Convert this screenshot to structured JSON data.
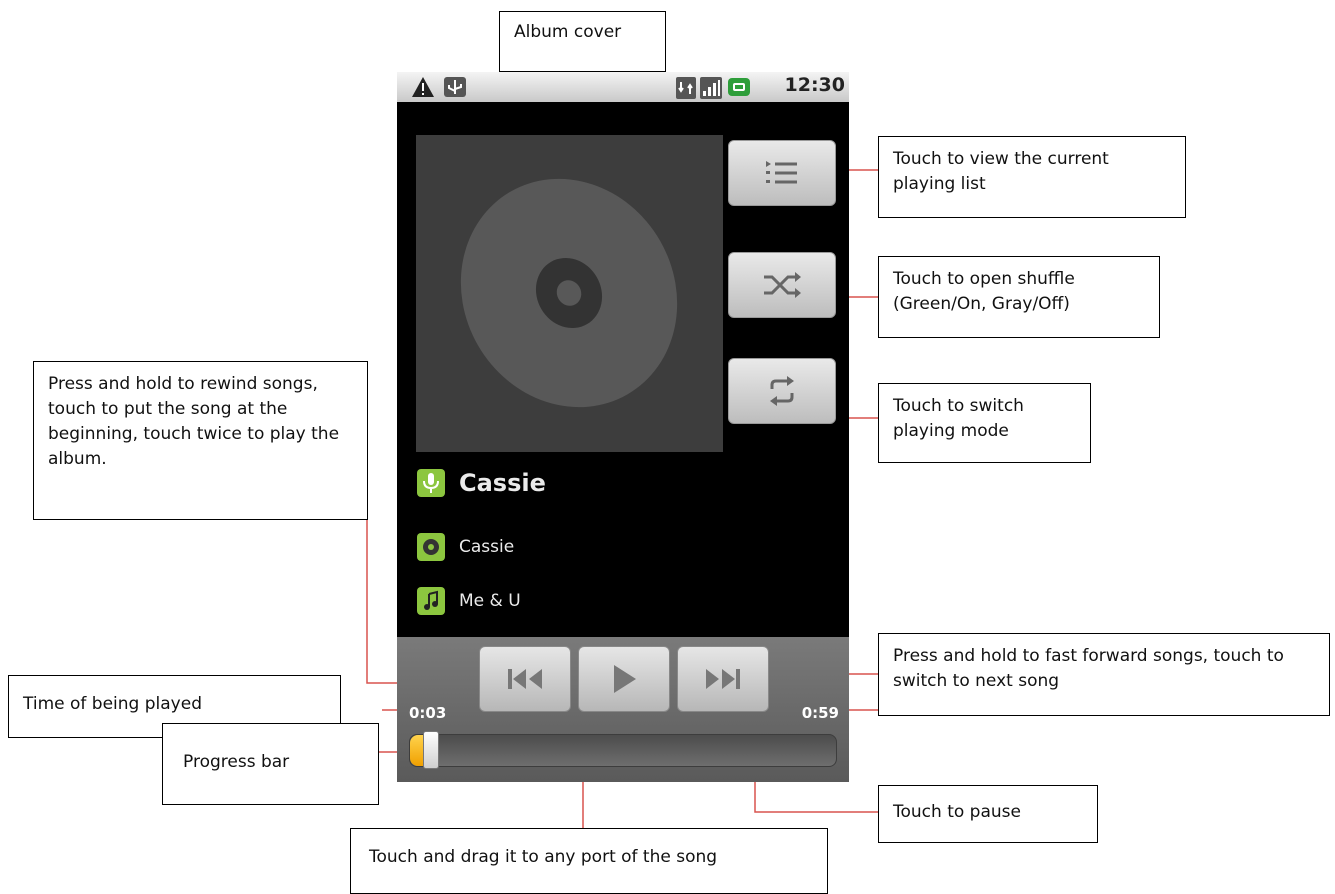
{
  "status_bar": {
    "time": "12:30",
    "icons": [
      "warning-icon",
      "usb-icon",
      "data-icon",
      "signal-icon",
      "battery-icon"
    ]
  },
  "player": {
    "artist": "Cassie",
    "album": "Cassie",
    "song": "Me & U",
    "elapsed": "0:03",
    "duration": "0:59",
    "progress_fraction": 0.05,
    "buttons": [
      "playlist-icon",
      "shuffle-icon",
      "repeat-icon",
      "rewind-icon",
      "play-icon",
      "fast-forward-icon"
    ]
  },
  "callouts": {
    "album_cover": "Album cover",
    "playlist": "Touch to view the current playing list",
    "shuffle": "Touch to open shuffle (Green/On, Gray/Off)",
    "repeat": "Touch to switch playing mode",
    "rewind": "Press and hold to rewind songs, touch to put the song at the beginning, touch twice to play the album.",
    "fast_forward": "Press and hold to fast forward songs, touch to switch to next song",
    "time_played": "Time of being played",
    "progress_bar": "Progress bar",
    "pause": "Touch to pause",
    "drag": "Touch and drag it to any port of the song"
  },
  "colors": {
    "connector": "#d9534f",
    "accent_green": "#8cc63f",
    "progress_fill": "#f5b400"
  }
}
